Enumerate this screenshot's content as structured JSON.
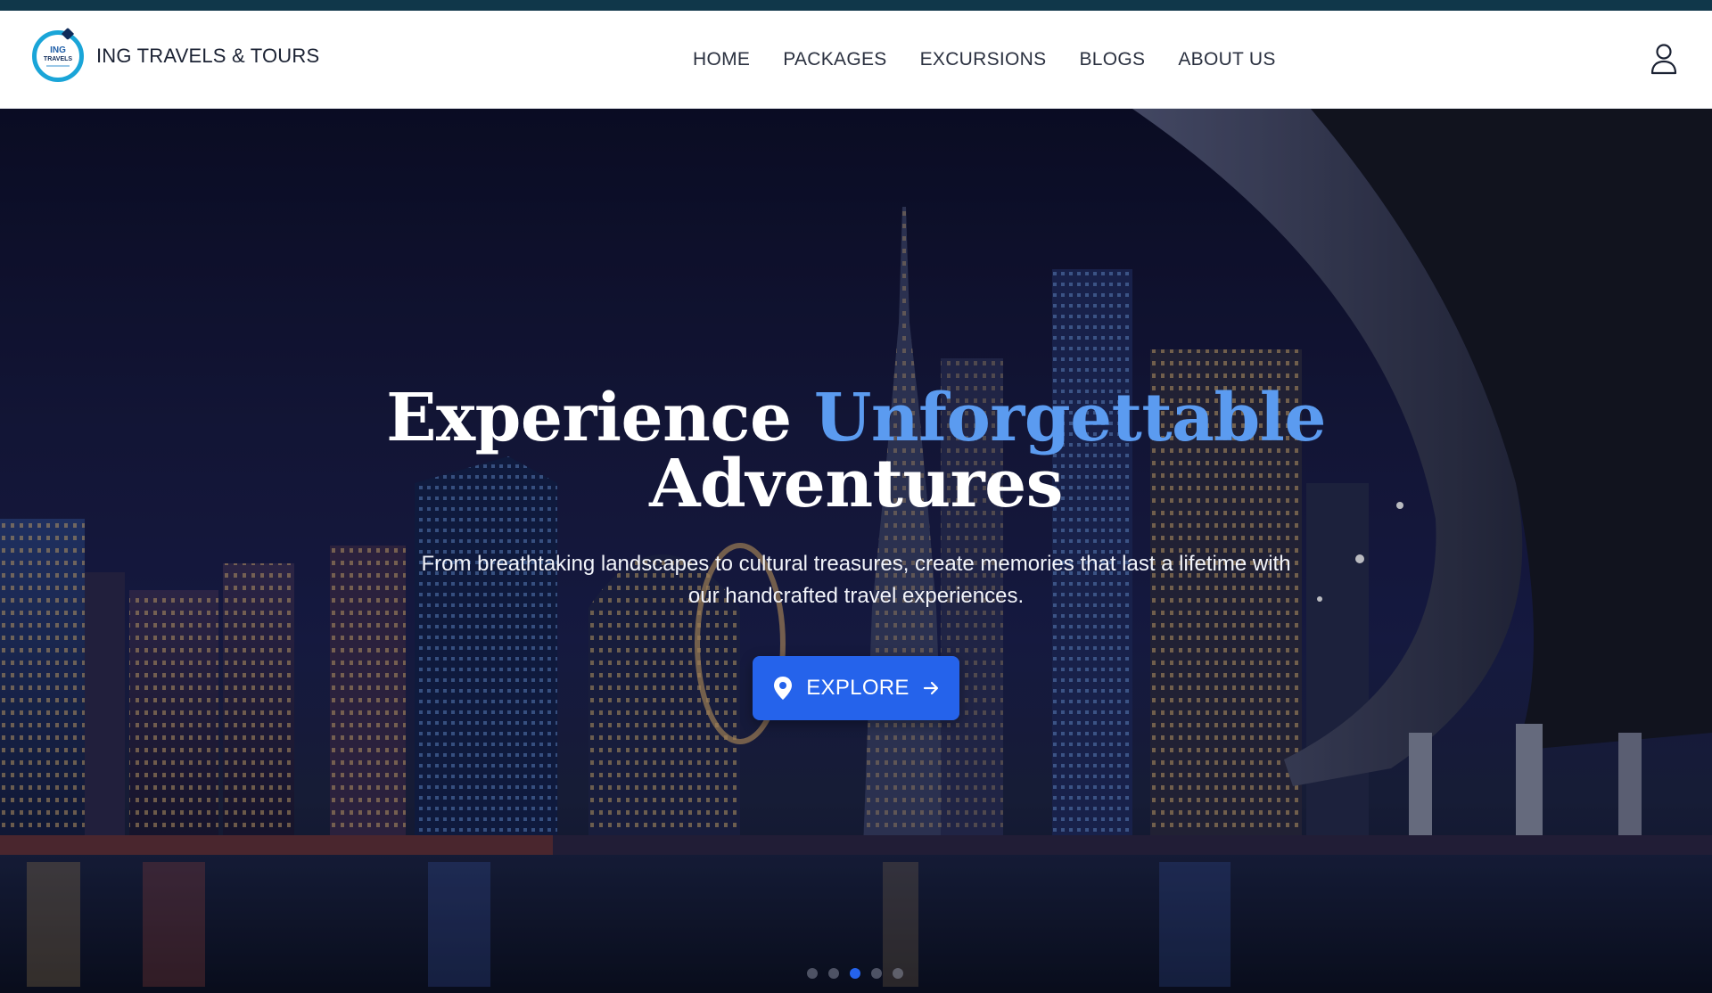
{
  "brand": {
    "logo_line1": "ING",
    "logo_line2": "TRAVELS",
    "name": "ING TRAVELS & TOURS"
  },
  "nav": {
    "items": [
      {
        "label": "HOME"
      },
      {
        "label": "PACKAGES"
      },
      {
        "label": "EXCURSIONS"
      },
      {
        "label": "BLOGS"
      },
      {
        "label": "ABOUT US"
      }
    ],
    "user_icon": "user-icon"
  },
  "hero": {
    "headline_part1": "Experience ",
    "headline_accent": "Unforgettable",
    "headline_line2": "Adventures",
    "subtext": "From breathtaking landscapes to cultural treasures, create memories that last a lifetime with our handcrafted travel experiences.",
    "cta_label": "EXPLORE",
    "cta_icon_left": "map-pin-icon",
    "cta_icon_right": "arrow-right-icon",
    "slides_total": 5,
    "active_slide": 3
  },
  "colors": {
    "accent": "#5b9bf0",
    "button": "#2563eb",
    "top_strip": "#10374a",
    "logo_ring": "#1aa5d8"
  }
}
